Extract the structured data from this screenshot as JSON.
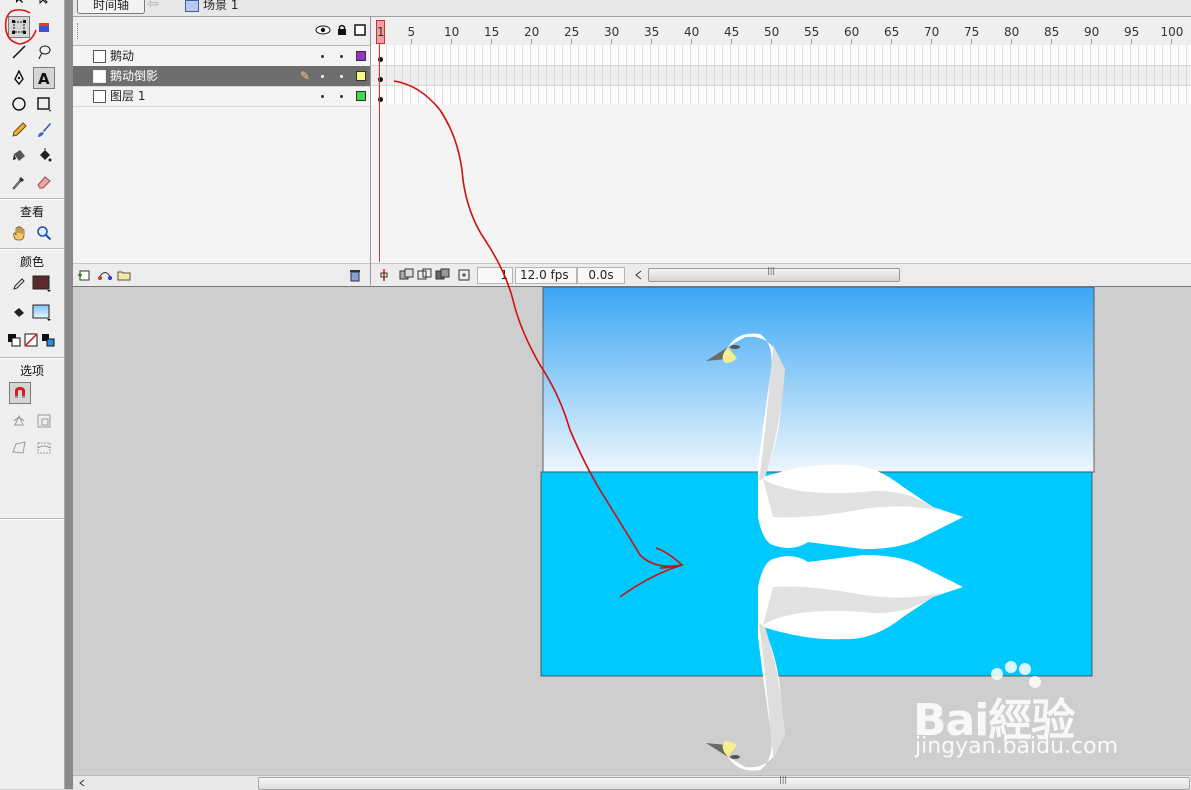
{
  "timeline_tab": "时间轴",
  "scene_name": "场景 1",
  "tools": {
    "view_label": "查看",
    "colors_label": "颜色",
    "options_label": "选项"
  },
  "layers": [
    {
      "name": "鹅动",
      "color": "#9b30c8",
      "selected": false
    },
    {
      "name": "鹅动倒影",
      "color": "#f7f78a",
      "selected": true
    },
    {
      "name": "图层 1",
      "color": "#3fd84a",
      "selected": false
    }
  ],
  "ruler_ticks": [
    "1",
    "5",
    "10",
    "15",
    "20",
    "25",
    "30",
    "35",
    "40",
    "45",
    "50",
    "55",
    "60",
    "65",
    "70",
    "75",
    "80",
    "85",
    "90",
    "95",
    "100"
  ],
  "frames_footer": {
    "current_frame": "1",
    "fps": "12.0 fps",
    "elapsed": "0.0s"
  },
  "stage": {
    "sky_top": "#3aa6f5",
    "sky_bottom": "#eef6fc",
    "water": "#00c9ff"
  },
  "watermark": {
    "logo": "Bai經验",
    "url": "jingyan.baidu.com"
  }
}
